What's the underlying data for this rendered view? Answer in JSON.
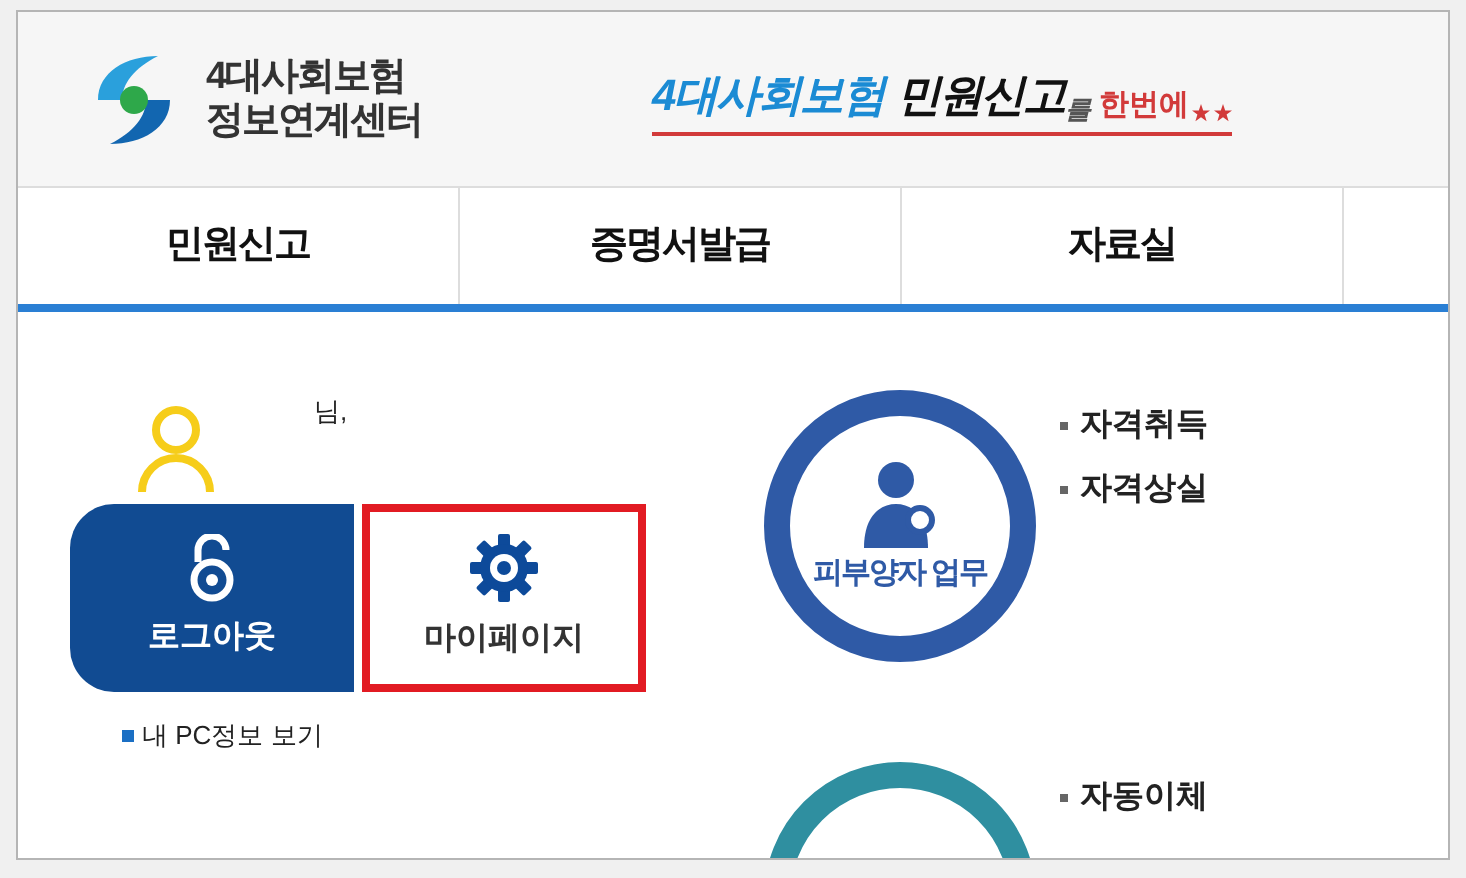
{
  "header": {
    "logo_lines": [
      "4대사회보험",
      "정보연계센터"
    ],
    "slogan": {
      "blue": "4대사회보험",
      "dark": "민원신고",
      "small": "를",
      "red": "한번에"
    }
  },
  "nav": [
    "민원신고",
    "증명서발급",
    "자료실"
  ],
  "user": {
    "greeting": "님,"
  },
  "buttons": [
    {
      "kind": "logout",
      "label": "로그아웃",
      "highlighted": false
    },
    {
      "kind": "mypage",
      "label": "마이페이지",
      "highlighted": true
    }
  ],
  "pc_info_link": "내 PC정보 보기",
  "categories": [
    {
      "title": "피부양자 업무",
      "color": "#2f5aa6",
      "links": [
        "자격취득",
        "자격상실"
      ]
    },
    {
      "color": "#2f8fa0",
      "links": [
        "자동이체"
      ]
    }
  ]
}
